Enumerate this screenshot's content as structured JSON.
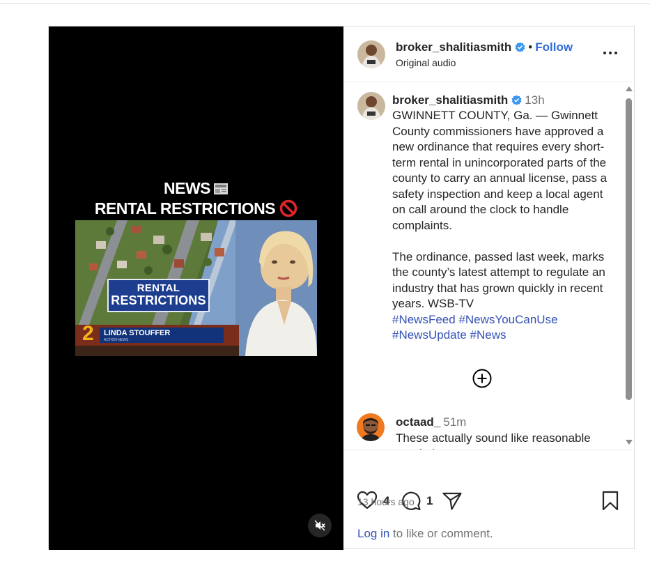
{
  "video": {
    "title_line1": "NEWS",
    "title_line2": "RENTAL RESTRICTIONS",
    "banner_line1": "RENTAL",
    "banner_line2": "RESTRICTIONS",
    "channel_number": "2",
    "anchor_name": "LINDA STOUFFER",
    "anchor_sub": "ACTION NEWS",
    "mute_icon": "speaker-muted-icon"
  },
  "header": {
    "username": "broker_shalitiasmith",
    "separator": "•",
    "follow_label": "Follow",
    "audio_label": "Original audio",
    "more_icon": "more-horizontal-icon"
  },
  "caption": {
    "username": "broker_shalitiasmith",
    "time": "13h",
    "text": "GWINNETT COUNTY, Ga. — Gwinnett County commissioners have approved a new ordinance that requires every short-term rental in unincorporated parts of the county to carry an annual license, pass a safety inspection and keep a local agent on call around the clock to handle complaints.\n\nThe ordinance, passed last week, marks the county’s latest attempt to regulate an industry that has grown quickly in recent years. WSB-TV",
    "hashtags": [
      "#NewsFeed",
      "#NewsYouCanUse",
      "#NewsUpdate",
      "#News"
    ]
  },
  "comment": {
    "username": "octaad_",
    "time": "51m",
    "text": "These actually sound like reasonable regulations"
  },
  "actions": {
    "like_count": "4",
    "comment_count": "1",
    "time_ago": "13 hours ago",
    "login_link": "Log in",
    "login_rest": " to like or comment."
  },
  "colors": {
    "link_blue": "#3452b4",
    "follow_blue": "#2f6bd8",
    "verified_blue": "#3897f0",
    "secondary_text": "#737373"
  }
}
